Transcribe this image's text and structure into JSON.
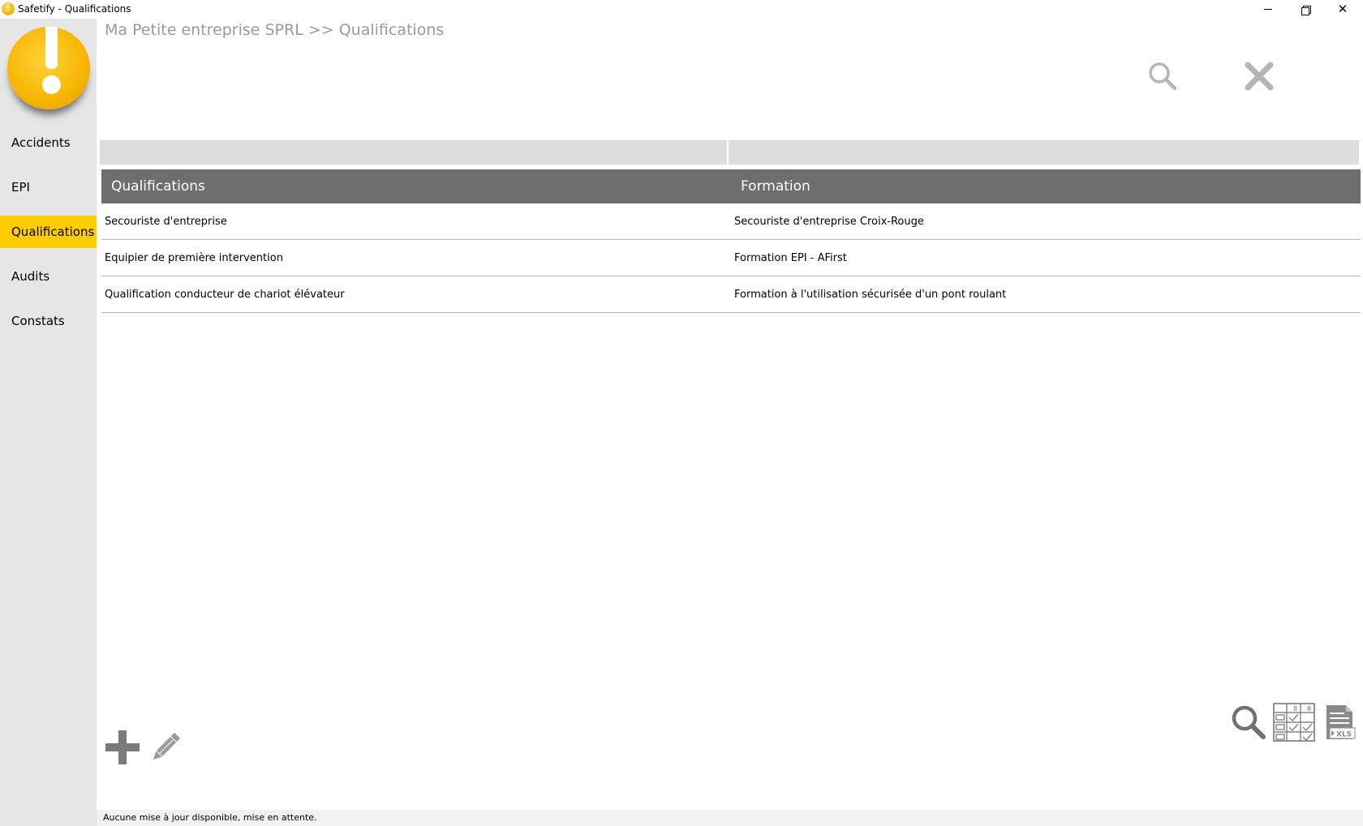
{
  "window": {
    "title": "Safetify - Qualifications",
    "minimize_icon": "minimize-icon",
    "restore_icon": "restore-icon",
    "close_icon": "close-icon"
  },
  "sidebar": {
    "logo_icon": "exclamation-logo",
    "items": [
      {
        "label": "Accidents",
        "active": false
      },
      {
        "label": "EPI",
        "active": false
      },
      {
        "label": "Qualifications",
        "active": true
      },
      {
        "label": "Audits",
        "active": false
      },
      {
        "label": "Constats",
        "active": false
      }
    ],
    "active_color": "#ffcc00"
  },
  "breadcrumb": "Ma Petite entreprise SPRL >> Qualifications",
  "top_actions": {
    "search_icon": "search-icon",
    "close_icon": "close-icon"
  },
  "table": {
    "columns": [
      "Qualifications",
      "Formation"
    ],
    "rows": [
      [
        "Secouriste d'entreprise",
        "Secouriste d'entreprise Croix-Rouge"
      ],
      [
        "Equipier de première intervention",
        "Formation EPI - AFirst"
      ],
      [
        "Qualification conducteur de chariot élévateur",
        "Formation à l'utilisation sécurisée d'un pont roulant"
      ]
    ],
    "header_color": "#6e6e6e"
  },
  "bottom_tools": {
    "add_icon": "plus-icon",
    "edit_icon": "pencil-icon",
    "search_icon": "magnifier-icon",
    "columns_icon": "column-chooser-icon",
    "export_icon": "xls-export-icon",
    "export_label": "XLS"
  },
  "status": "Aucune mise à jour disponible, mise en attente."
}
